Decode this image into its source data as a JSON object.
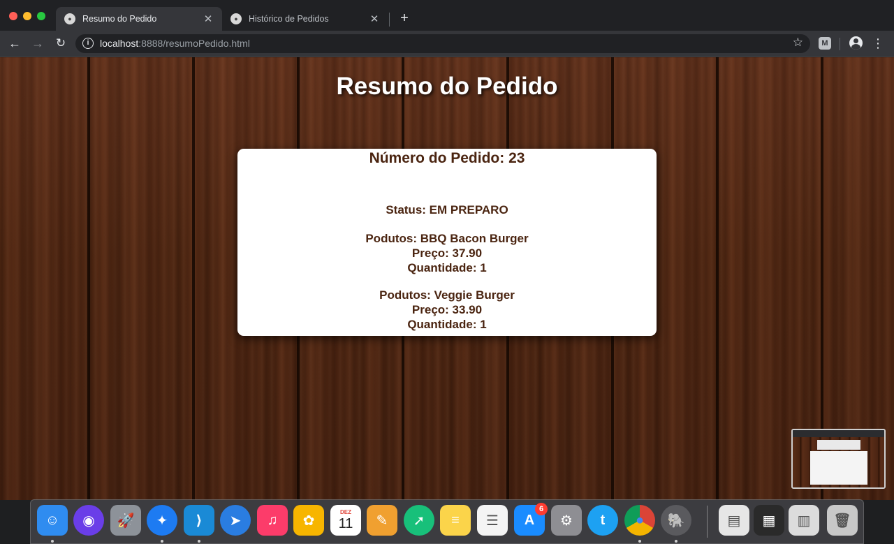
{
  "browser": {
    "tabs": [
      {
        "title": "Resumo do Pedido",
        "active": true,
        "close": "✕"
      },
      {
        "title": "Histórico de Pedidos",
        "active": false,
        "close": "✕"
      }
    ],
    "new_tab": "+",
    "url_host": "localhost",
    "url_rest": ":8888/resumoPedido.html",
    "ext_label": "M",
    "nav": {
      "back": "←",
      "forward": "→",
      "reload": "↻",
      "bookmark": "☆",
      "menu": "⋮",
      "info": "i"
    }
  },
  "page": {
    "title": "Resumo do Pedido",
    "order_number": "Número do Pedido: 23",
    "status": "Status: EM PREPARO",
    "products": [
      {
        "name": "Podutos: BBQ Bacon Burger",
        "price": "Preço: 37.90",
        "quantity": "Quantidade: 1"
      },
      {
        "name": "Podutos: Veggie Burger",
        "price": "Preço: 33.90",
        "quantity": "Quantidade: 1"
      }
    ]
  },
  "dock": {
    "apps": [
      {
        "name": "Finder",
        "icon": "finder-icon",
        "glyph": "☺",
        "color": "#2f8cf0"
      },
      {
        "name": "Siri",
        "icon": "siri-icon",
        "glyph": "◉",
        "color": "#6a3ee8"
      },
      {
        "name": "Launchpad",
        "icon": "launchpad-icon",
        "glyph": "🚀",
        "color": "#8d9299"
      },
      {
        "name": "Safari",
        "icon": "safari-icon",
        "glyph": "✦",
        "color": "#1d7bf2"
      },
      {
        "name": "Visual Studio Code",
        "icon": "vscode-icon",
        "glyph": "⟩",
        "color": "#1a8ad6"
      },
      {
        "name": "Spark",
        "icon": "spark-icon",
        "glyph": "➤",
        "color": "#2a7de1"
      },
      {
        "name": "Music",
        "icon": "music-icon",
        "glyph": "♫",
        "color": "#fc3c6a"
      },
      {
        "name": "Photos",
        "icon": "photos-icon",
        "glyph": "✿",
        "color": "#f7b500"
      },
      {
        "name": "Calendar",
        "icon": "calendar-icon",
        "glyph": "11",
        "month": "DEZ",
        "color": "#ffffff"
      },
      {
        "name": "Pages",
        "icon": "pages-icon",
        "glyph": "✎",
        "color": "#f0a030"
      },
      {
        "name": "Send",
        "icon": "send-icon",
        "glyph": "➚",
        "color": "#18c07a"
      },
      {
        "name": "Notes",
        "icon": "notes-icon",
        "glyph": "≡",
        "color": "#fbd44a"
      },
      {
        "name": "Reminders",
        "icon": "reminders-icon",
        "glyph": "☰",
        "color": "#f4f4f4"
      },
      {
        "name": "App Store",
        "icon": "app-store-icon",
        "glyph": "A",
        "color": "#1a8cff",
        "badge": "6"
      },
      {
        "name": "System Preferences",
        "icon": "system-preferences-icon",
        "glyph": "⚙",
        "color": "#8e8e93"
      },
      {
        "name": "Twitter",
        "icon": "twitter-icon",
        "glyph": "t",
        "color": "#1da1f2"
      },
      {
        "name": "Chrome",
        "icon": "chrome-icon",
        "glyph": "●",
        "color": "#ffffff"
      },
      {
        "name": "TablePlus",
        "icon": "elephant-icon",
        "glyph": "🐘",
        "color": "#5a5a5e"
      },
      {
        "name": "Document",
        "icon": "document-icon",
        "glyph": "▤",
        "color": "#e6e6e6"
      },
      {
        "name": "Screenshot",
        "icon": "screenshot-stack-icon",
        "glyph": "▦",
        "color": "#2a2a2a"
      },
      {
        "name": "Downloads",
        "icon": "downloads-stack-icon",
        "glyph": "▥",
        "color": "#dcdcdc"
      },
      {
        "name": "Trash",
        "icon": "trash-icon",
        "glyph": "🗑",
        "color": "#c8c8c8"
      }
    ]
  }
}
